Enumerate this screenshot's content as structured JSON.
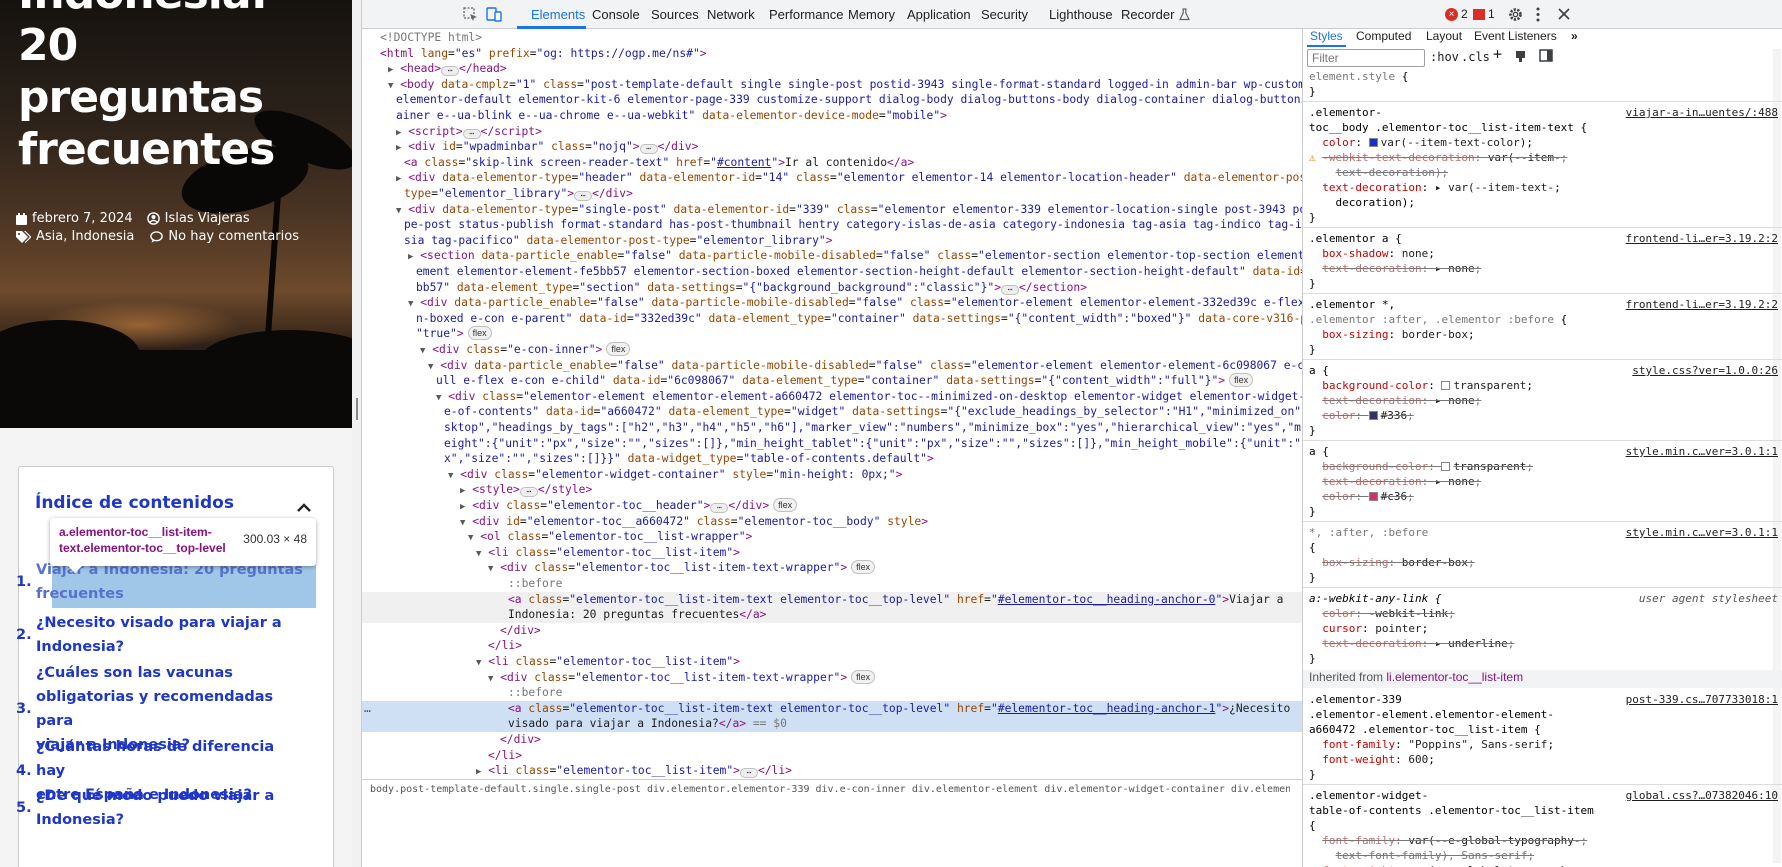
{
  "page": {
    "title_lines": [
      "Indonesia:",
      "20",
      "preguntas",
      "frecuentes"
    ],
    "date": "febrero 7, 2024",
    "author": "Islas Viajeras",
    "categories": "Asia, Indonesia",
    "comments": "No hay comentarios",
    "toc_heading": "Índice de contenidos",
    "toc_items": [
      {
        "num": "1.",
        "lines": [
          "Viajar a Indonesia: 20 preguntas",
          "frecuentes"
        ]
      },
      {
        "num": "2.",
        "lines": [
          "¿Necesito visado para viajar a",
          "Indonesia?"
        ]
      },
      {
        "num": "3.",
        "lines": [
          "¿Cuáles son las vacunas",
          "obligatorias y recomendadas para",
          "viajar a Indonesia?"
        ]
      },
      {
        "num": "4.",
        "lines": [
          "¿Cuántas horas de diferencia hay",
          "entre España e Indonesia?"
        ]
      },
      {
        "num": "5.",
        "lines": [
          "¿De qué modo puedo viajar a",
          "Indonesia?"
        ]
      }
    ],
    "tooltip_selector": "a.elementor-toc__list-item-text.elementor-toc__top-level",
    "tooltip_size": "300.03 × 48"
  },
  "devtools": {
    "tabs": [
      "Elements",
      "Console",
      "Sources",
      "Network",
      "Performance",
      "Memory",
      "Application",
      "Security",
      "Lighthouse",
      "Recorder"
    ],
    "active_tab": "Elements",
    "error_count": "2",
    "issue_count": "1",
    "styles_tabs": [
      "Styles",
      "Computed",
      "Layout",
      "Event Listeners"
    ],
    "active_styles_tab": "Styles",
    "filter_placeholder": "Filter",
    "hov_label": ":hov",
    "cls_label": ".cls",
    "selected_suffix": "== $0",
    "breadcrumbs": "body.post-template-default.single.single-post   div.elementor.elementor-339   div.e-con-inner   div.elementor-element   div.elementor-widget-container   div.elementor-toc__body   ol.elementor-toc__list-wrapper   li.elementor-toc__list-item   a.elementor-toc__list-item-text"
  },
  "accent": "#1a73e8",
  "link_color": "#1e37c8"
}
